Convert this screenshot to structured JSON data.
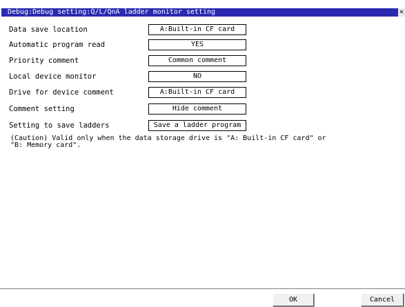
{
  "window": {
    "title": "Debug:Debug setting:Q/L/QnA ladder monitor setting",
    "close_label": "×"
  },
  "settings": [
    {
      "label": "Data save location",
      "value": "A:Built-in CF card"
    },
    {
      "label": "Automatic program read",
      "value": "YES"
    },
    {
      "label": "Priority comment",
      "value": "Common comment"
    },
    {
      "label": "Local device monitor",
      "value": "NO"
    },
    {
      "label": "Drive for device comment",
      "value": "A:Built-in CF card"
    },
    {
      "label": "Comment setting",
      "value": "Hide comment"
    },
    {
      "label": "Setting to save ladders",
      "value": "Save a ladder program"
    }
  ],
  "caution": {
    "line1": "(Caution) Valid only when the data storage drive is \"A: Built-in CF card\" or",
    "line2": "\"B: Memory card\"."
  },
  "buttons": {
    "ok": "OK",
    "cancel": "Cancel"
  }
}
